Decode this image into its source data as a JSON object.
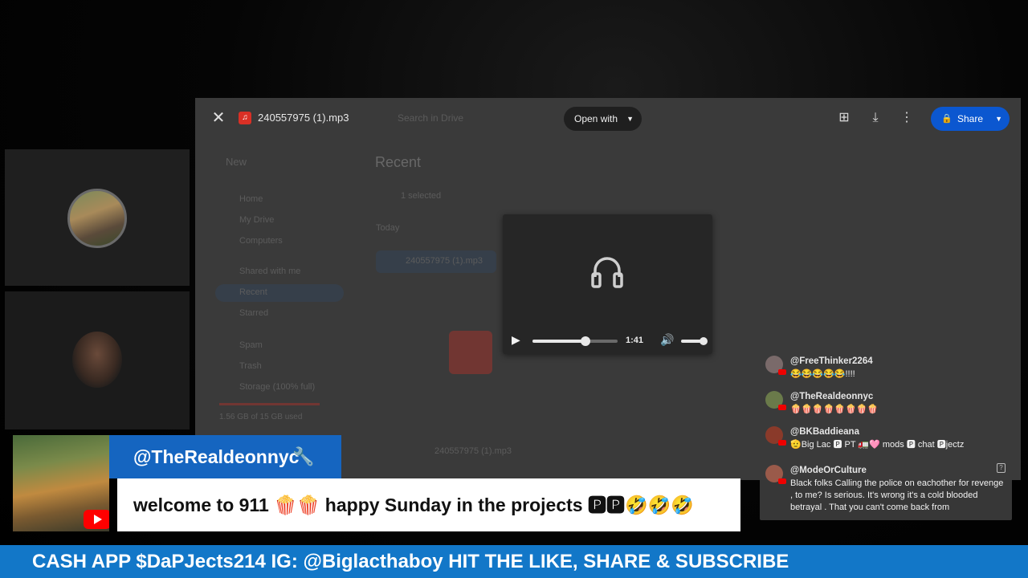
{
  "viewer": {
    "file_title": "240557975 (1).mp3",
    "search_placeholder": "Search in Drive",
    "open_with_label": "Open with",
    "share_label": "Share"
  },
  "drive_bg": {
    "new_label": "New",
    "nav": [
      "Home",
      "My Drive",
      "Computers",
      "Shared with me",
      "Recent",
      "Starred",
      "Spam",
      "Trash",
      "Storage (100% full)"
    ],
    "storage_text": "1.56 GB of 15 GB used",
    "heading": "Recent",
    "selection_text": "1 selected",
    "today_label": "Today",
    "file_row": "240557975 (1).mp3"
  },
  "player": {
    "time": "1:41",
    "progress": 0.62,
    "volume": 1.0
  },
  "chat": [
    {
      "name": "@FreeThinker2264",
      "text": "😂😂😂😂😂!!!!",
      "avatar_color": "#7a6a6a"
    },
    {
      "name": "@TheRealdeonnyc",
      "text": "🍿🍿🍿🍿🍿🍿🍿🍿",
      "avatar_color": "#6a7a4a"
    },
    {
      "name": "@BKBaddieana",
      "text": "🫡Big Lac 🅿 PT 🚛🩷 mods 🅿 chat 🅿jectz",
      "avatar_color": "#8a3a2a"
    },
    {
      "name": "@ModeOrCulture",
      "text": "Black folks Calling the police on eachother for revenge , to me? Is serious. It's wrong it's a cold blooded betrayal . That you can't come back from",
      "avatar_color": "#9a5a4a"
    }
  ],
  "lower_third": {
    "name": "@TheRealdeonnyc",
    "wrench": "🔧",
    "message": "welcome to 911 🍿🍿 happy Sunday in the projects 🅿🅿🤣🤣🤣"
  },
  "ticker": {
    "text": "CASH APP $DaPJects214 IG: @Biglacthaboy HIT THE LIKE, SHARE & SUBSCRIBE"
  },
  "colors": {
    "share_blue": "#0b57d0",
    "lower_third_blue": "#1565c0",
    "ticker_blue": "#1277c8"
  }
}
